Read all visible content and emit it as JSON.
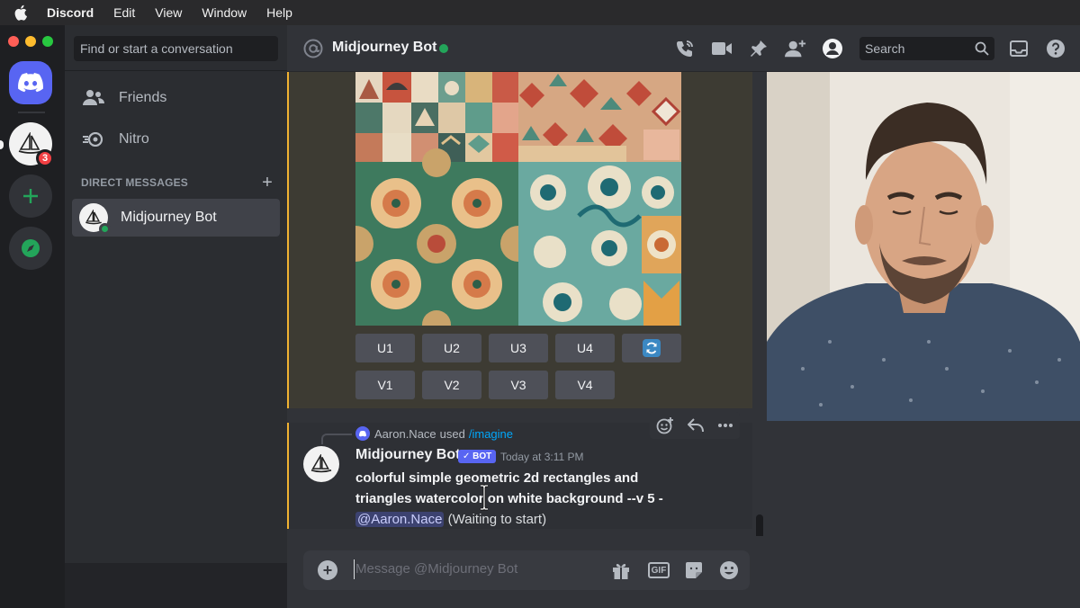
{
  "menubar": {
    "app": "Discord",
    "items": [
      "Edit",
      "View",
      "Window",
      "Help"
    ]
  },
  "rail": {
    "badge": "3"
  },
  "sidebar": {
    "search_placeholder": "Find or start a conversation",
    "nav": [
      {
        "label": "Friends",
        "icon": "friends-icon"
      },
      {
        "label": "Nitro",
        "icon": "nitro-icon"
      }
    ],
    "dm_header": "DIRECT MESSAGES",
    "dm_add": "+",
    "dms": [
      {
        "name": "Midjourney Bot",
        "status": "online"
      }
    ]
  },
  "header": {
    "channel": "Midjourney Bot",
    "search_placeholder": "Search"
  },
  "message1": {
    "upscale_buttons": [
      "U1",
      "U2",
      "U3",
      "U4"
    ],
    "variation_buttons": [
      "V1",
      "V2",
      "V3",
      "V4"
    ],
    "reroll_icon": "refresh-icon"
  },
  "message2": {
    "reply_user": "Aaron.Nace",
    "reply_text": "used",
    "reply_command": "/imagine",
    "author": "Midjourney Bot",
    "bot_tag": "✓ BOT",
    "timestamp": "Today at 3:11 PM",
    "prompt": "colorful simple geometric 2d rectangles and triangles watercolor on white background --v 5",
    "separator": " - ",
    "mention": "@Aaron.Nace",
    "status": "(Waiting to start)"
  },
  "composer": {
    "placeholder": "Message @Midjourney Bot",
    "gif_label": "GIF"
  },
  "colors": {
    "blurple": "#5865f2",
    "online": "#23a55a",
    "highlight": "#f0b232",
    "mention_bg": "#3c4270"
  }
}
